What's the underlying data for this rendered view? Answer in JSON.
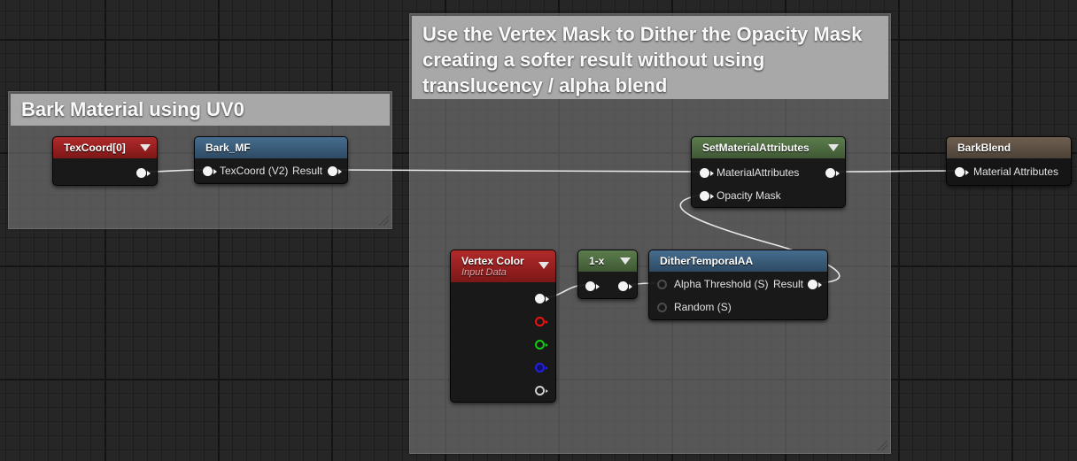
{
  "comments": {
    "bark": {
      "title": "Bark Material using UV0"
    },
    "dither": {
      "title": "Use the Vertex Mask to Dither the Opacity Mask creating a softer result without using translucency / alpha blend"
    }
  },
  "nodes": {
    "texcoord": {
      "title": "TexCoord[0]"
    },
    "bark_mf": {
      "title": "Bark_MF",
      "input_label": "TexCoord (V2)",
      "output_label": "Result"
    },
    "set_material_attributes": {
      "title": "SetMaterialAttributes",
      "inputs": [
        "MaterialAttributes",
        "Opacity Mask"
      ]
    },
    "bark_blend": {
      "title": "BarkBlend",
      "input_label": "Material Attributes"
    },
    "vertex_color": {
      "title": "Vertex Color",
      "subtitle": "Input Data"
    },
    "one_minus": {
      "title": "1-x"
    },
    "dither_temporal_aa": {
      "title": "DitherTemporalAA",
      "inputs": [
        "Alpha Threshold (S)",
        "Random (S)"
      ],
      "output_label": "Result"
    }
  },
  "colors": {
    "canvas": "#262626",
    "comment_title_bg": "#a8a8a8",
    "header_red": "#9a2020",
    "header_blue": "#3c5f7e",
    "header_green": "#4f6e42",
    "header_brown": "#5e5145",
    "pin_red": "#ee1111",
    "pin_green": "#11cc11",
    "pin_blue": "#2222dd"
  },
  "icons": [
    "collapse-arrow-icon",
    "exec-pin-icon",
    "resize-grip-icon"
  ]
}
